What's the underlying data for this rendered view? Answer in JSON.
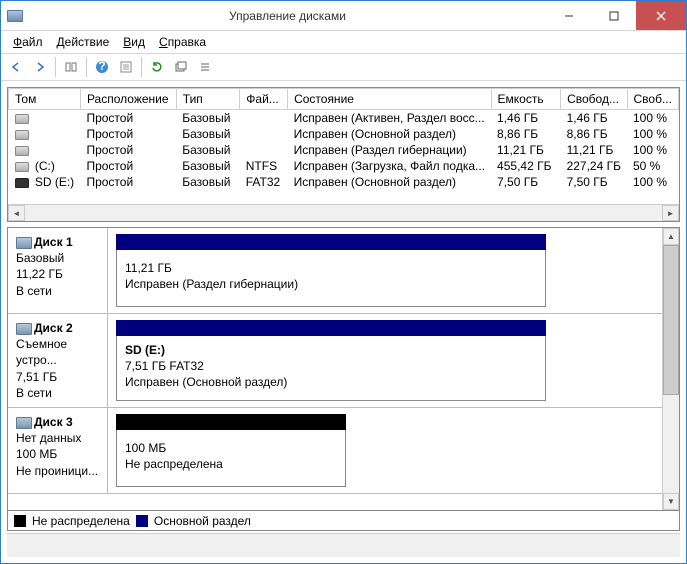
{
  "window": {
    "title": "Управление дисками"
  },
  "menu": {
    "file": "Файл",
    "action": "Действие",
    "view": "Вид",
    "help": "Справка"
  },
  "columns": {
    "volume": "Том",
    "layout": "Расположение",
    "type": "Тип",
    "fs": "Фай...",
    "status": "Состояние",
    "capacity": "Емкость",
    "free": "Свобод...",
    "pct": "Своб..."
  },
  "volumes": [
    {
      "name": "",
      "layout": "Простой",
      "type": "Базовый",
      "fs": "",
      "status": "Исправен (Активен, Раздел восс...",
      "capacity": "1,46 ГБ",
      "free": "1,46 ГБ",
      "pct": "100 %"
    },
    {
      "name": "",
      "layout": "Простой",
      "type": "Базовый",
      "fs": "",
      "status": "Исправен (Основной раздел)",
      "capacity": "8,86 ГБ",
      "free": "8,86 ГБ",
      "pct": "100 %"
    },
    {
      "name": "",
      "layout": "Простой",
      "type": "Базовый",
      "fs": "",
      "status": "Исправен (Раздел гибернации)",
      "capacity": "11,21 ГБ",
      "free": "11,21 ГБ",
      "pct": "100 %"
    },
    {
      "name": "(C:)",
      "layout": "Простой",
      "type": "Базовый",
      "fs": "NTFS",
      "status": "Исправен (Загрузка, Файл подка...",
      "capacity": "455,42 ГБ",
      "free": "227,24 ГБ",
      "pct": "50 %"
    },
    {
      "name": "SD (E:)",
      "layout": "Простой",
      "type": "Базовый",
      "fs": "FAT32",
      "status": "Исправен (Основной раздел)",
      "capacity": "7,50 ГБ",
      "free": "7,50 ГБ",
      "pct": "100 %",
      "sd": true
    }
  ],
  "disks": [
    {
      "title": "Диск 1",
      "sub1": "Базовый",
      "sub2": "11,22 ГБ",
      "sub3": "В сети",
      "part": {
        "line1": "",
        "line2": "11,21 ГБ",
        "line3": "Исправен (Раздел гибернации)",
        "hdr": "blue"
      }
    },
    {
      "title": "Диск 2",
      "sub1": "Съемное устро...",
      "sub2": "7,51 ГБ",
      "sub3": "В сети",
      "part": {
        "line1": "SD  (E:)",
        "line2": "7,51 ГБ FAT32",
        "line3": "Исправен (Основной раздел)",
        "hdr": "blue",
        "bold1": true
      }
    },
    {
      "title": "Диск 3",
      "sub1": "Нет данных",
      "sub2": "100 МБ",
      "sub3": "Не проиници...",
      "q": true,
      "part": {
        "line1": "",
        "line2": "100 МБ",
        "line3": "Не распределена",
        "hdr": "black",
        "narrow": true
      }
    }
  ],
  "legend": {
    "unalloc": "Не распределена",
    "primary": "Основной раздел"
  }
}
